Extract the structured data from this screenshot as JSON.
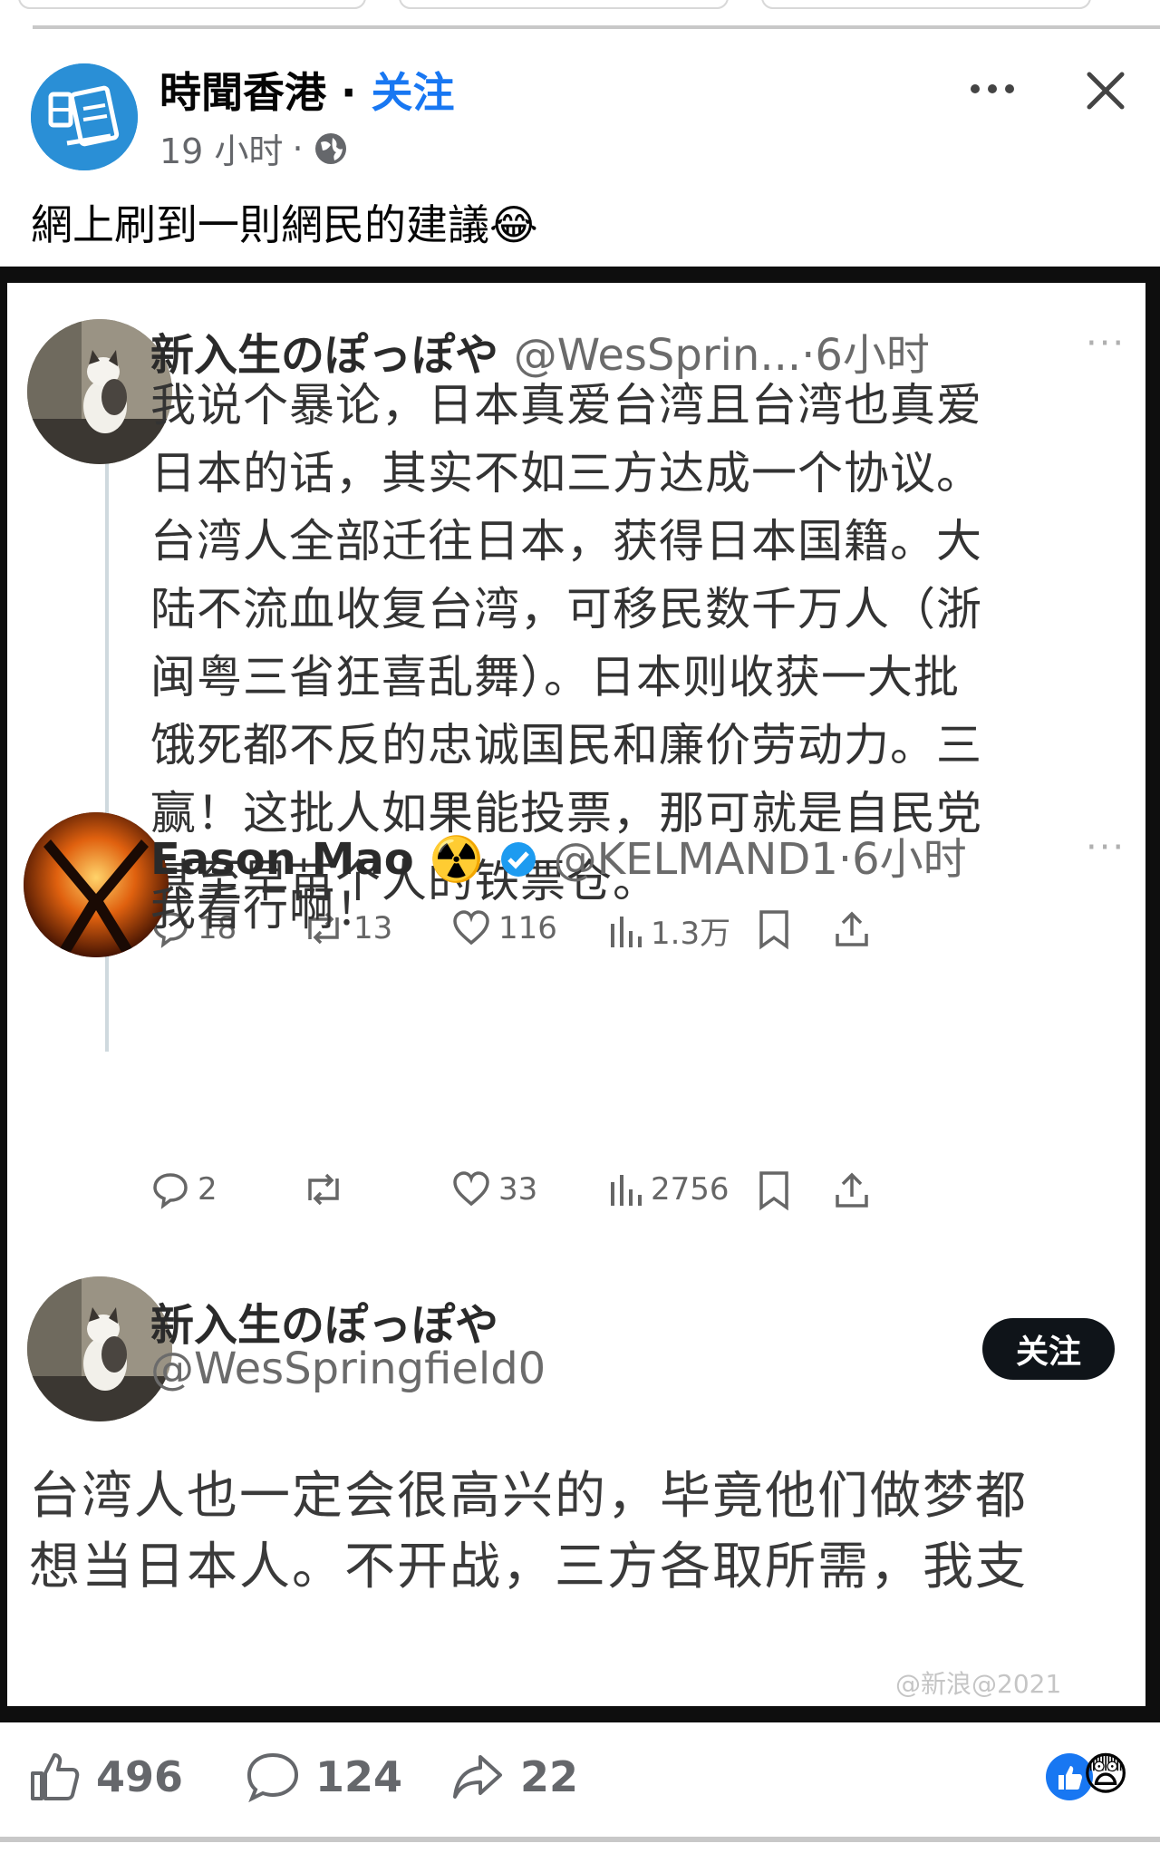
{
  "post": {
    "page_name": "時聞香港",
    "separator": "·",
    "follow_label": "关注",
    "time": "19 小时",
    "meta_dot": "·",
    "text": "網上刷到一則網民的建議😂",
    "avatar_label": "時聞香港"
  },
  "embed": {
    "tweet1": {
      "name": "新入生のぽっぽや",
      "handle_time": "@WesSprin...·6小时",
      "more": "···",
      "body": [
        "我说个暴论，日本真爱台湾且台湾也真爱",
        "日本的话，其实不如三方达成一个协议。",
        "台湾人全部迁往日本，获得日本国籍。大",
        "陆不流血收复台湾，可移民数千万人（浙",
        "闽粤三省狂喜乱舞）。日本则收获一大批",
        "饿死都不反的忠诚国民和廉价劳动力。三",
        "赢！这批人如果能投票，那可就是自民党",
        "甚至早苗个人的铁票仓。"
      ],
      "replies": "18",
      "reposts": "13",
      "likes": "116",
      "views": "1.3万"
    },
    "tweet2": {
      "name": "Eason Mao",
      "badge_emoji": "☢️",
      "handle_time": "@KELMAND1·6小时",
      "more": "···",
      "body": "我看行啊！",
      "replies": "2",
      "reposts": "",
      "likes": "33",
      "views": "2756"
    },
    "tweet3": {
      "name": "新入生のぽっぽや",
      "handle": "@WesSpringfield0",
      "follow_label": "关注",
      "body": [
        "台湾人也一定会很高兴的，毕竟他们做梦都",
        "想当日本人。不开战，三方各取所需，我支"
      ]
    },
    "watermark": "@新浪@2021"
  },
  "footer": {
    "likes": "496",
    "comments": "124",
    "shares": "22",
    "reaction_emoji": "😨"
  },
  "colors": {
    "link": "#1877f2",
    "page_avatar": "#2a8fd6",
    "meta": "#65676b",
    "shot_border": "#0e0e0e"
  }
}
